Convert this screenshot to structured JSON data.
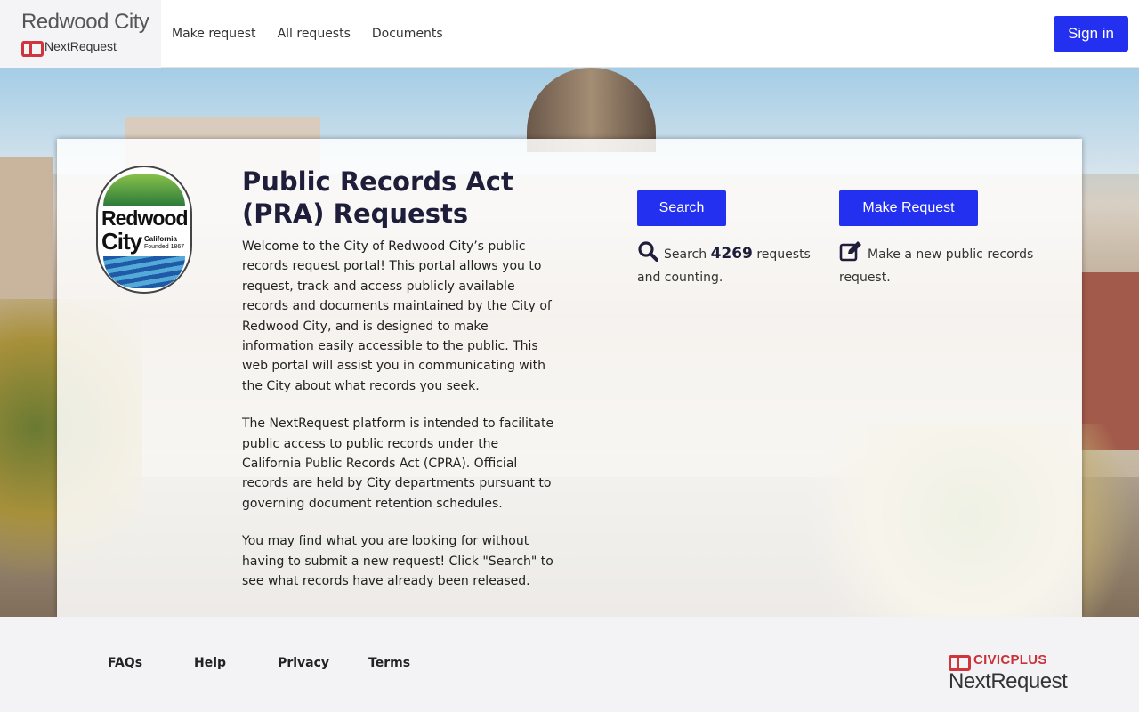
{
  "header": {
    "brand_city": "Redwood City",
    "brand_product": "NextRequest",
    "nav": [
      {
        "label": "Make request"
      },
      {
        "label": "All requests"
      },
      {
        "label": "Documents"
      }
    ],
    "signin_label": "Sign in"
  },
  "seal": {
    "word1": "Redwood",
    "word2": "City",
    "tag1": "California",
    "tag2": "Founded 1867"
  },
  "intro": {
    "title": "Public Records Act (PRA) Requests",
    "paragraphs": [
      "Welcome to the City of Redwood City’s public records request portal! This portal allows you to request, track and access publicly available records and documents maintained by the City of Redwood City, and is designed to make information easily accessible to the public. This web portal will assist you in communicating with the City about what records you seek.",
      "The NextRequest platform is intended to facilitate public access to public records under the California Public Records Act (CPRA). Official records are held by City departments pursuant to governing document retention schedules.",
      "You may find what you are looking for without having to submit a new request! Click \"Search\" to see what records have already been released."
    ]
  },
  "search": {
    "button_label": "Search",
    "prefix": "Search",
    "count": "4269",
    "suffix": "requests and counting.",
    "icon": "search-icon"
  },
  "request": {
    "button_label": "Make Request",
    "text": "Make a new public records request.",
    "icon": "edit-icon"
  },
  "footer": {
    "links": [
      {
        "label": "FAQs"
      },
      {
        "label": "Help"
      },
      {
        "label": "Privacy"
      },
      {
        "label": "Terms"
      }
    ],
    "civic_top": "CIVICPLUS",
    "civic_bottom": "NextRequest"
  },
  "colors": {
    "primary": "#2430f0",
    "title": "#1e1e3a",
    "civic_red": "#c8323a"
  }
}
